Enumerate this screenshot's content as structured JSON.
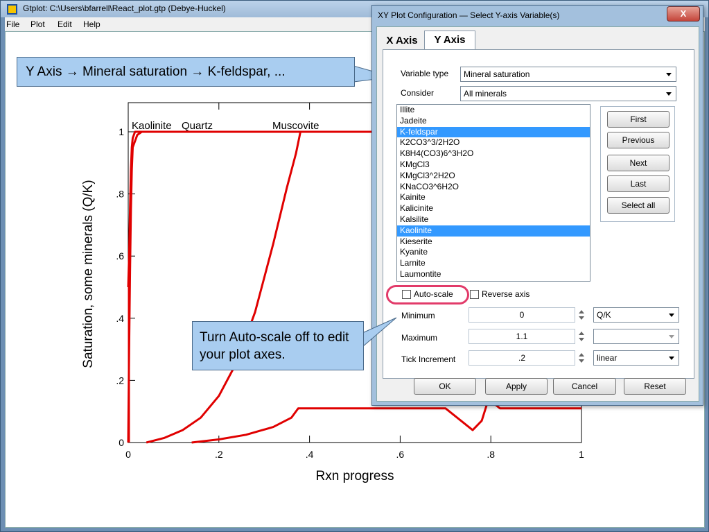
{
  "main_window": {
    "title": "Gtplot:    C:\\Users\\bfarrell\\React_plot.gtp  (Debye-Huckel)",
    "menu": [
      "File",
      "Plot",
      "Edit",
      "Help"
    ]
  },
  "plot": {
    "chart_data": {
      "type": "line",
      "xlabel": "Rxn progress",
      "ylabel": "Saturation, some minerals (Q/K)",
      "xlim": [
        0,
        1
      ],
      "ylim": [
        0,
        1.1
      ],
      "x_ticks": [
        "0",
        ".2",
        ".4",
        ".6",
        ".8",
        "1"
      ],
      "y_ticks": [
        "0",
        ".2",
        ".4",
        ".6",
        ".8",
        "1"
      ],
      "curve_labels": [
        "Kaolinite",
        "Quartz",
        "Muscovite"
      ],
      "series": [
        {
          "x": [
            0,
            0.002,
            0.004,
            0.006,
            0.008,
            0.01,
            0.015,
            0.02,
            1.0
          ],
          "y": [
            0.5,
            0.6,
            0.75,
            0.88,
            0.95,
            0.98,
            1.0,
            1.0,
            1.0
          ]
        },
        {
          "x": [
            0.0,
            0.002,
            0.004,
            0.006,
            0.008,
            0.01,
            0.02,
            0.03,
            0.05,
            1.0
          ],
          "y": [
            0.0,
            0.3,
            0.55,
            0.75,
            0.88,
            0.95,
            0.99,
            1.0,
            1.0,
            1.0
          ]
        },
        {
          "x": [
            0.04,
            0.08,
            0.12,
            0.16,
            0.2,
            0.24,
            0.28,
            0.32,
            0.35,
            0.37,
            0.38,
            1.0
          ],
          "y": [
            0.0,
            0.015,
            0.04,
            0.08,
            0.15,
            0.26,
            0.42,
            0.64,
            0.82,
            0.93,
            1.0,
            1.0
          ]
        },
        {
          "x": [
            0.14,
            0.2,
            0.26,
            0.32,
            0.36,
            0.375,
            0.4,
            0.5,
            0.6,
            0.7,
            0.76,
            0.78,
            0.795,
            0.82,
            0.9,
            1.0
          ],
          "y": [
            0.0,
            0.01,
            0.025,
            0.05,
            0.08,
            0.11,
            0.11,
            0.11,
            0.11,
            0.11,
            0.04,
            0.07,
            0.14,
            0.11,
            0.11,
            0.11
          ]
        }
      ]
    }
  },
  "callouts": {
    "top": "Y Axis → Mineral saturation → K-feldspar, ...",
    "mid": "Turn Auto-scale off to edit your plot axes."
  },
  "dialog": {
    "title": "XY Plot Configuration — Select Y-axis Variable(s)",
    "close_glyph": "X",
    "tabs": [
      "X Axis",
      "Y Axis"
    ],
    "variable_type_label": "Variable type",
    "variable_type_value": "Mineral saturation",
    "consider_label": "Consider",
    "consider_value": "All minerals",
    "list_items": [
      {
        "label": "Illite",
        "selected": false
      },
      {
        "label": "Jadeite",
        "selected": false
      },
      {
        "label": "K-feldspar",
        "selected": true
      },
      {
        "label": "K2CO3^3/2H2O",
        "selected": false
      },
      {
        "label": "K8H4(CO3)6^3H2O",
        "selected": false
      },
      {
        "label": "KMgCl3",
        "selected": false
      },
      {
        "label": "KMgCl3^2H2O",
        "selected": false
      },
      {
        "label": "KNaCO3^6H2O",
        "selected": false
      },
      {
        "label": "Kainite",
        "selected": false
      },
      {
        "label": "Kalicinite",
        "selected": false
      },
      {
        "label": "Kalsilite",
        "selected": false
      },
      {
        "label": "Kaolinite",
        "selected": true
      },
      {
        "label": "Kieserite",
        "selected": false
      },
      {
        "label": "Kyanite",
        "selected": false
      },
      {
        "label": "Larnite",
        "selected": false
      },
      {
        "label": "Laumontite",
        "selected": false
      }
    ],
    "nav_buttons": [
      "First",
      "Previous",
      "Next",
      "Last",
      "Select all"
    ],
    "autoscale_label": "Auto-scale",
    "autoscale_checked": false,
    "reverse_label": "Reverse axis",
    "reverse_checked": false,
    "minimum_label": "Minimum",
    "minimum_value": "0",
    "maximum_label": "Maximum",
    "maximum_value": "1.1",
    "tick_label": "Tick Increment",
    "tick_value": ".2",
    "units_value": "Q/K",
    "scale_value": "linear",
    "buttons": [
      "OK",
      "Apply",
      "Cancel",
      "Reset"
    ]
  }
}
